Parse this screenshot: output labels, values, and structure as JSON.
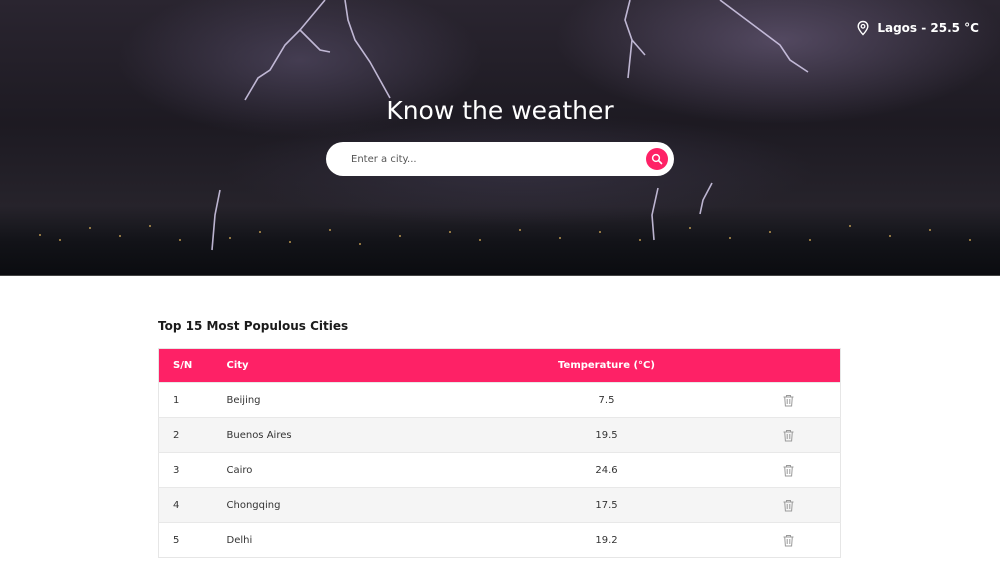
{
  "header": {
    "location_label": "Lagos - 25.5 °C",
    "location_icon": "map-pin-icon",
    "title": "Know the weather"
  },
  "search": {
    "placeholder": "Enter a city...",
    "value": "",
    "button_icon": "search-icon"
  },
  "table": {
    "title": "Top 15 Most Populous Cities",
    "columns": {
      "sn": "S/N",
      "city": "City",
      "temperature": "Temperature (°C)"
    },
    "delete_icon": "trash-icon",
    "rows": [
      {
        "sn": "1",
        "city": "Beijing",
        "temperature": "7.5"
      },
      {
        "sn": "2",
        "city": "Buenos Aires",
        "temperature": "19.5"
      },
      {
        "sn": "3",
        "city": "Cairo",
        "temperature": "24.6"
      },
      {
        "sn": "4",
        "city": "Chongqing",
        "temperature": "17.5"
      },
      {
        "sn": "5",
        "city": "Delhi",
        "temperature": "19.2"
      }
    ]
  },
  "colors": {
    "accent": "#fe2166",
    "row_alt": "#f5f5f5",
    "hero_dark": "#1d1a22"
  }
}
